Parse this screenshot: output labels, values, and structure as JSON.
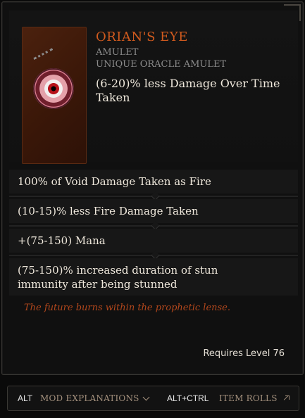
{
  "item": {
    "name": "Orian's Eye",
    "base_type": "Amulet",
    "subtype": "Unique Oracle Amulet",
    "implicit": "(6-20)% less Damage Over Time Taken"
  },
  "mods": [
    "100% of Void Damage Taken as Fire",
    "(10-15)% less Fire Damage Taken",
    "+(75-150) Mana",
    "(75-150)% increased duration of stun immunity after being stunned"
  ],
  "flavor_text": "The future burns within the prophetic lense.",
  "requirements": "Requires Level 76",
  "footer": {
    "alt_key": "ALT",
    "alt_label": "Mod Explanations",
    "altctrl_key": "ALT+CTRL",
    "altctrl_label": "Item Rolls"
  },
  "icons": {
    "item_art": "orians-eye-amulet-icon",
    "chevron": "chevron-down-icon",
    "external": "arrow-up-right-icon"
  },
  "colors": {
    "unique_title": "#d05a1e",
    "flavor": "#b2471c",
    "mod_text": "#efe8dc",
    "muted": "#8c8c8c",
    "footer_label": "#a28f7c"
  }
}
